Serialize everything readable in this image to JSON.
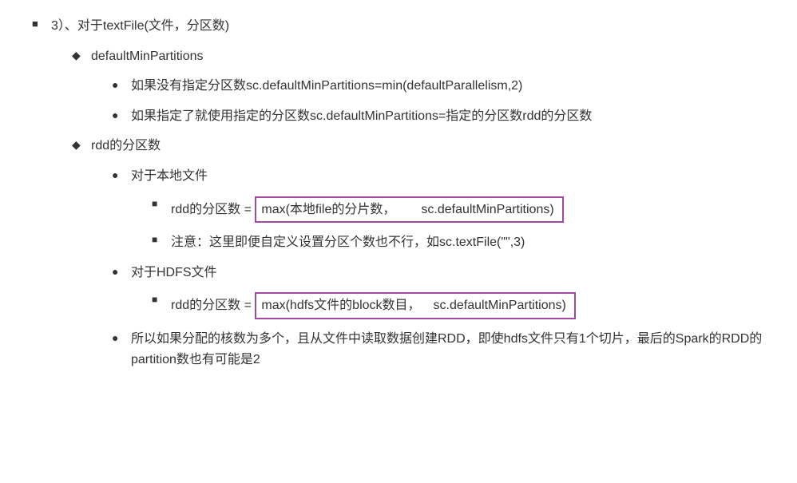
{
  "l1": {
    "bullet": "■",
    "text": "3）、对于textFile(文件，分区数)"
  },
  "l2_1": {
    "bullet": "◆",
    "text": "defaultMinPartitions"
  },
  "l3_1": {
    "bullet": "●",
    "text": "如果没有指定分区数sc.defaultMinPartitions=min(defaultParallelism,2)"
  },
  "l3_2": {
    "bullet": "●",
    "text": "如果指定了就使用指定的分区数sc.defaultMinPartitions=指定的分区数rdd的分区数"
  },
  "l2_2": {
    "bullet": "◆",
    "text": "rdd的分区数"
  },
  "l3_3": {
    "bullet": "●",
    "text": "对于本地文件"
  },
  "l4_1": {
    "bullet": "■",
    "prefix": "rdd的分区数 =",
    "highlight": "max(本地file的分片数，  sc.defaultMinPartitions)"
  },
  "l4_2": {
    "bullet": "■",
    "text": "注意：这里即便自定义设置分区个数也不行，如sc.textFile(\"\",3)"
  },
  "l3_4": {
    "bullet": "●",
    "text": "对于HDFS文件"
  },
  "l4_3": {
    "bullet": "■",
    "prefix": "rdd的分区数 =",
    "highlight": "max(hdfs文件的block数目， sc.defaultMinPartitions)"
  },
  "l3_5": {
    "bullet": "●",
    "text": "所以如果分配的核数为多个，且从文件中读取数据创建RDD，即使hdfs文件只有1个切片，最后的Spark的RDD的partition数也有可能是2"
  }
}
